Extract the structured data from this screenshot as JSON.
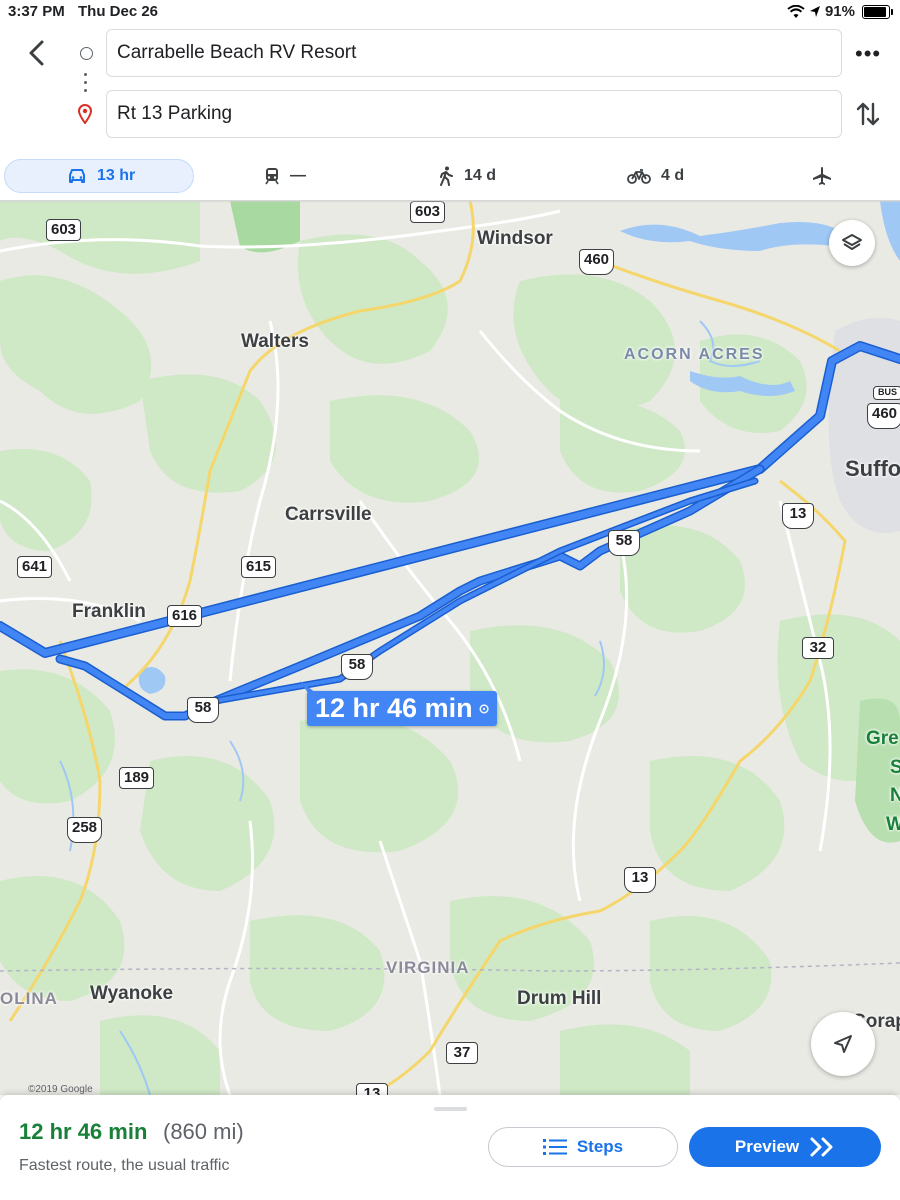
{
  "status_bar": {
    "time": "3:37 PM",
    "date": "Thu Dec 26",
    "battery": "91%",
    "battery_level": 0.91
  },
  "directions": {
    "origin": "Carrabelle Beach RV Resort",
    "destination": "Rt 13 Parking"
  },
  "modes": {
    "drive": "13 hr",
    "transit": "—",
    "walk": "14 d",
    "bike": "4 d"
  },
  "map": {
    "places": {
      "windsor": "Windsor",
      "walters": "Walters",
      "acorn_acres": "ACORN ACRES",
      "suffolk": "Suffo",
      "carrsville": "Carrsville",
      "franklin": "Franklin",
      "virginia": "VIRGINIA",
      "wyanoke": "Wyanoke",
      "drum_hill": "Drum Hill",
      "olina": "OLINA",
      "corap": "Corap",
      "gre": "Gre",
      "s": "S",
      "n": "N",
      "w": "W"
    },
    "shields": {
      "r603a": "603",
      "r603b": "603",
      "r460": "460",
      "bus": "BUS",
      "r460b": "460",
      "r641": "641",
      "r615": "615",
      "r616": "616",
      "r58a": "58",
      "r58b": "58",
      "r58c": "58",
      "r13a": "13",
      "r13b": "13",
      "r32": "32",
      "r189": "189",
      "r258": "258",
      "r37": "37",
      "r58d": "13"
    },
    "route_label": "12 hr 46 min",
    "copyright": "©2019 Google",
    "colors": {
      "route": "#4285f4",
      "route_outline": "#1a5fd0",
      "water": "#9fc8f5",
      "park": "#c9e8c0"
    }
  },
  "summary": {
    "duration": "12 hr 46 min",
    "distance": "(860 mi)",
    "subtitle": "Fastest route, the usual traffic",
    "steps_label": "Steps",
    "preview_label": "Preview"
  }
}
